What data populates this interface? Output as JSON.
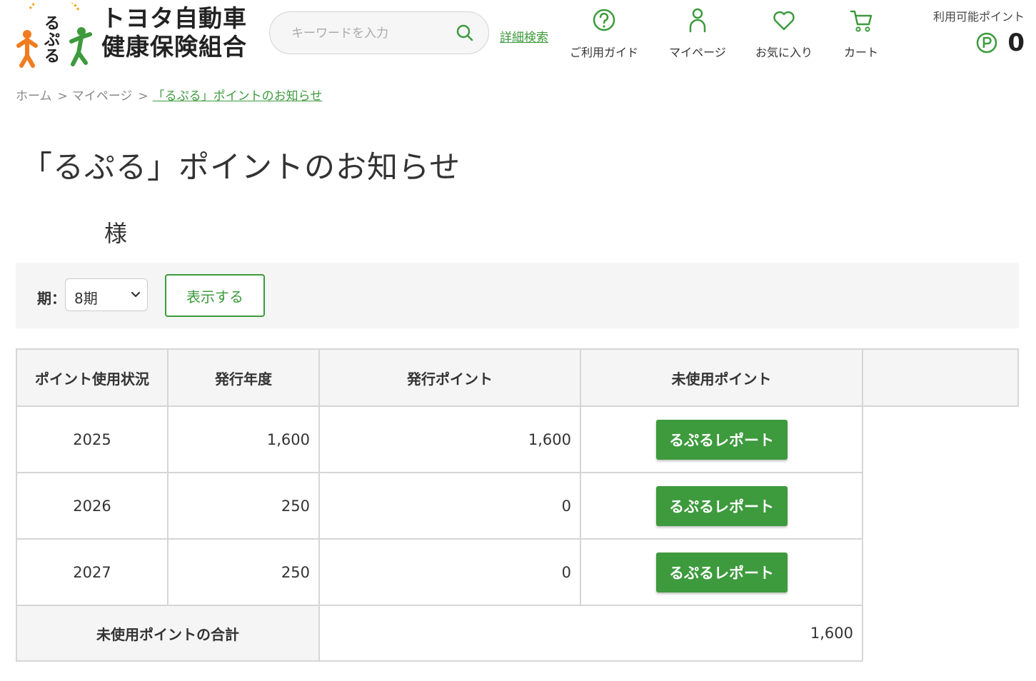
{
  "brand": {
    "name_line1": "トヨタ自動車",
    "name_line2": "健康保険組合",
    "logo_text": "るぷる"
  },
  "header": {
    "search_placeholder": "キーワードを入力",
    "advanced_search": "詳細検索",
    "nav": [
      {
        "label": "ご利用ガイド",
        "icon": "help-circle-icon"
      },
      {
        "label": "マイページ",
        "icon": "person-icon"
      },
      {
        "label": "お気に入り",
        "icon": "heart-icon"
      },
      {
        "label": "カート",
        "icon": "cart-icon"
      }
    ],
    "points_label": "利用可能ポイント",
    "points_value": "0",
    "points_icon": "p-coin-icon"
  },
  "breadcrumb": {
    "home": "ホーム",
    "mypage": "マイページ",
    "current": "「るぷる」ポイントのお知らせ",
    "separator": ">"
  },
  "page": {
    "title": "「るぷる」ポイントのお知らせ",
    "user_suffix": "様"
  },
  "filter": {
    "label": "期：",
    "selected_period": "8期",
    "show_button": "表示する"
  },
  "table": {
    "row_header": "ポイント使用状況",
    "headers": [
      "発行年度",
      "発行ポイント",
      "未使用ポイント",
      ""
    ],
    "rows": [
      {
        "year": "2025",
        "issued": "1,600",
        "unused": "1,600",
        "action": "るぷるレポート"
      },
      {
        "year": "2026",
        "issued": "250",
        "unused": "0",
        "action": "るぷるレポート"
      },
      {
        "year": "2027",
        "issued": "250",
        "unused": "0",
        "action": "るぷるレポート"
      }
    ],
    "total_label": "未使用ポイントの合計",
    "total_value": "1,600"
  },
  "colors": {
    "accent": "#3d9a3d",
    "panel": "#f5f5f5",
    "border": "#d6d6d6"
  }
}
